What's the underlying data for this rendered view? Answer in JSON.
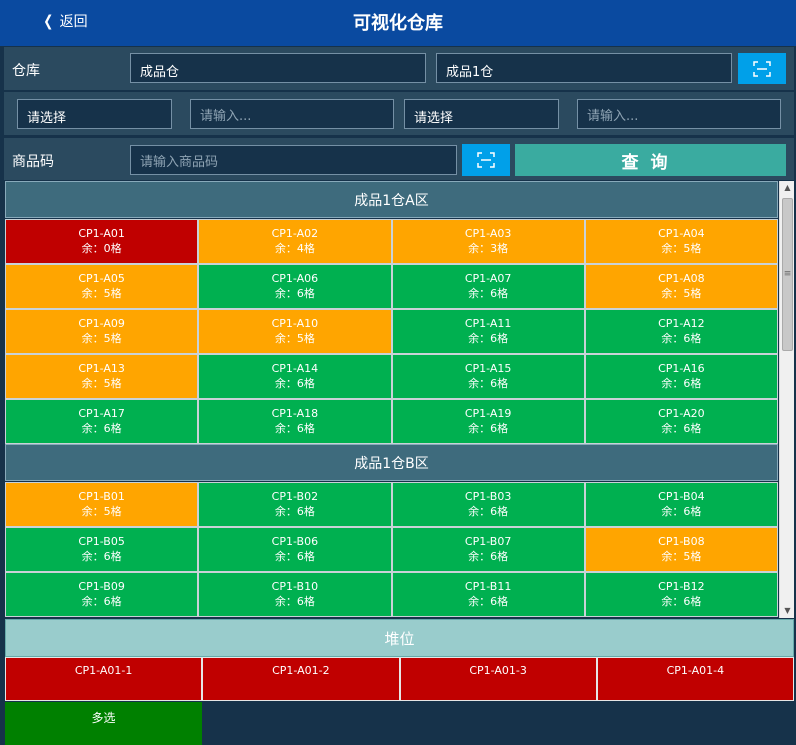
{
  "header": {
    "back_label": "返回",
    "title": "可视化仓库"
  },
  "filters": {
    "warehouse_label": "仓库",
    "warehouse_value": "成品仓",
    "sub_warehouse_value": "成品1仓",
    "select1_value": "请选择",
    "input1_placeholder": "请输入...",
    "select2_value": "请选择",
    "input2_placeholder": "请输入...",
    "product_code_label": "商品码",
    "product_code_placeholder": "请输入商品码",
    "query_label": "查询"
  },
  "zones": [
    {
      "name": "成品1仓A区",
      "cells": [
        {
          "code": "CP1-A01",
          "remain": "余：0格",
          "status": "red"
        },
        {
          "code": "CP1-A02",
          "remain": "余：4格",
          "status": "orange"
        },
        {
          "code": "CP1-A03",
          "remain": "余：3格",
          "status": "orange"
        },
        {
          "code": "CP1-A04",
          "remain": "余：5格",
          "status": "orange"
        },
        {
          "code": "CP1-A05",
          "remain": "余：5格",
          "status": "orange"
        },
        {
          "code": "CP1-A06",
          "remain": "余：6格",
          "status": "green"
        },
        {
          "code": "CP1-A07",
          "remain": "余：6格",
          "status": "green"
        },
        {
          "code": "CP1-A08",
          "remain": "余：5格",
          "status": "orange"
        },
        {
          "code": "CP1-A09",
          "remain": "余：5格",
          "status": "orange"
        },
        {
          "code": "CP1-A10",
          "remain": "余：5格",
          "status": "orange"
        },
        {
          "code": "CP1-A11",
          "remain": "余：6格",
          "status": "green"
        },
        {
          "code": "CP1-A12",
          "remain": "余：6格",
          "status": "green"
        },
        {
          "code": "CP1-A13",
          "remain": "余：5格",
          "status": "orange"
        },
        {
          "code": "CP1-A14",
          "remain": "余：6格",
          "status": "green"
        },
        {
          "code": "CP1-A15",
          "remain": "余：6格",
          "status": "green"
        },
        {
          "code": "CP1-A16",
          "remain": "余：6格",
          "status": "green"
        },
        {
          "code": "CP1-A17",
          "remain": "余：6格",
          "status": "green"
        },
        {
          "code": "CP1-A18",
          "remain": "余：6格",
          "status": "green"
        },
        {
          "code": "CP1-A19",
          "remain": "余：6格",
          "status": "green"
        },
        {
          "code": "CP1-A20",
          "remain": "余：6格",
          "status": "green"
        }
      ]
    },
    {
      "name": "成品1仓B区",
      "cells": [
        {
          "code": "CP1-B01",
          "remain": "余：5格",
          "status": "orange"
        },
        {
          "code": "CP1-B02",
          "remain": "余：6格",
          "status": "green"
        },
        {
          "code": "CP1-B03",
          "remain": "余：6格",
          "status": "green"
        },
        {
          "code": "CP1-B04",
          "remain": "余：6格",
          "status": "green"
        },
        {
          "code": "CP1-B05",
          "remain": "余：6格",
          "status": "green"
        },
        {
          "code": "CP1-B06",
          "remain": "余：6格",
          "status": "green"
        },
        {
          "code": "CP1-B07",
          "remain": "余：6格",
          "status": "green"
        },
        {
          "code": "CP1-B08",
          "remain": "余：5格",
          "status": "orange"
        },
        {
          "code": "CP1-B09",
          "remain": "余：6格",
          "status": "green"
        },
        {
          "code": "CP1-B10",
          "remain": "余：6格",
          "status": "green"
        },
        {
          "code": "CP1-B11",
          "remain": "余：6格",
          "status": "green"
        },
        {
          "code": "CP1-B12",
          "remain": "余：6格",
          "status": "green"
        }
      ]
    }
  ],
  "piles": {
    "title": "堆位",
    "items": [
      "CP1-A01-1",
      "CP1-A01-2",
      "CP1-A01-3",
      "CP1-A01-4"
    ],
    "multi_select_label": "多选"
  },
  "colors": {
    "green": "#00b050",
    "orange": "#ffa500",
    "red": "#c00000",
    "header_blue": "#0a4aa0",
    "scan_blue": "#00a0e9",
    "query_teal": "#3aaba0"
  },
  "icons": {
    "back": "chevron-left-icon",
    "scan": "scan-icon"
  }
}
